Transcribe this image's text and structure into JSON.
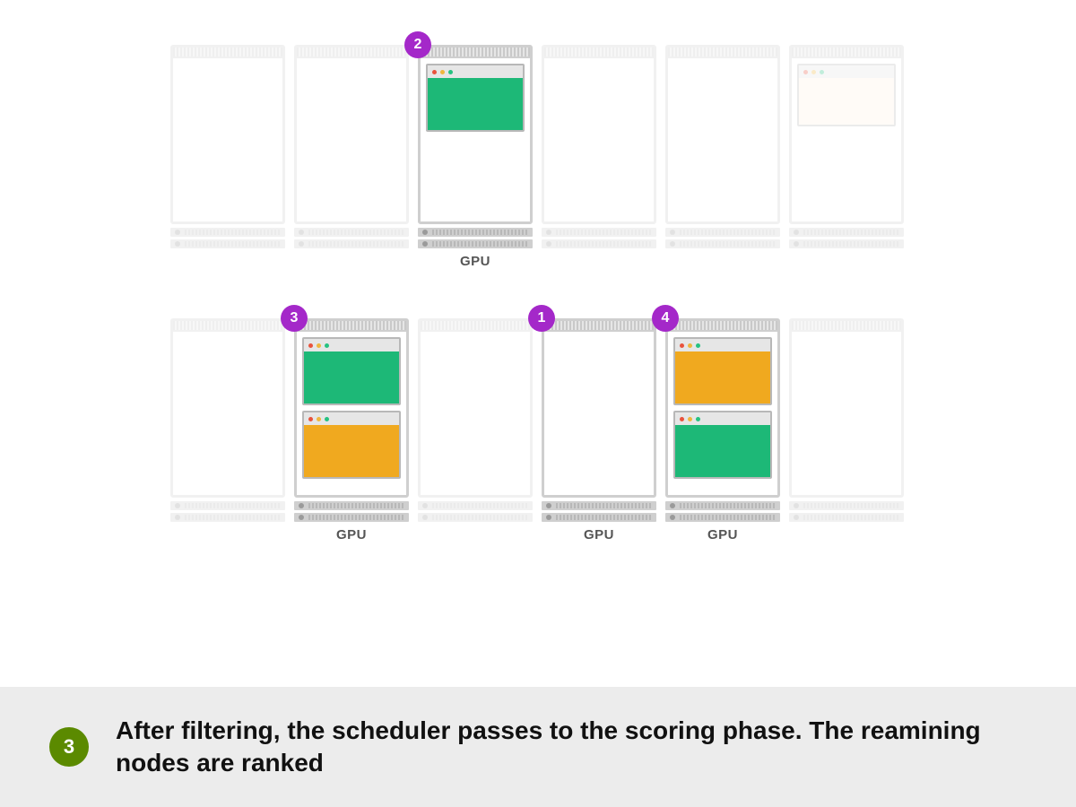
{
  "caption": {
    "step_number": "3",
    "text": "After filtering, the scheduler passes to the scoring phase. The reamining nodes are ranked"
  },
  "labels": {
    "gpu": "GPU"
  },
  "colors": {
    "rank_badge_bg": "#a428c9",
    "step_badge_bg": "#5b8a00",
    "pod_green": "#1db877",
    "pod_orange": "#f0a91f",
    "pod_cream": "#fff2e5"
  },
  "nodes": {
    "row1": [
      {
        "id": "r1n1",
        "faded": true,
        "rank": null,
        "gpu": false,
        "pods": []
      },
      {
        "id": "r1n2",
        "faded": true,
        "rank": null,
        "gpu": false,
        "pods": []
      },
      {
        "id": "r1n3",
        "faded": false,
        "rank": "2",
        "gpu": true,
        "pods": [
          {
            "color": "green"
          }
        ]
      },
      {
        "id": "r1n4",
        "faded": true,
        "rank": null,
        "gpu": false,
        "pods": []
      },
      {
        "id": "r1n5",
        "faded": true,
        "rank": null,
        "gpu": false,
        "pods": []
      },
      {
        "id": "r1n6",
        "faded": true,
        "rank": null,
        "gpu": false,
        "pods": [
          {
            "color": "cream"
          }
        ]
      }
    ],
    "row2": [
      {
        "id": "r2n1",
        "faded": true,
        "rank": null,
        "gpu": false,
        "pods": []
      },
      {
        "id": "r2n2",
        "faded": false,
        "rank": "3",
        "gpu": true,
        "pods": [
          {
            "color": "green"
          },
          {
            "color": "orange"
          }
        ]
      },
      {
        "id": "r2n3",
        "faded": true,
        "rank": null,
        "gpu": false,
        "pods": []
      },
      {
        "id": "r2n4",
        "faded": false,
        "rank": "1",
        "gpu": true,
        "pods": []
      },
      {
        "id": "r2n5",
        "faded": false,
        "rank": "4",
        "gpu": true,
        "pods": [
          {
            "color": "orange"
          },
          {
            "color": "green"
          }
        ]
      },
      {
        "id": "r2n6",
        "faded": true,
        "rank": null,
        "gpu": false,
        "pods": []
      }
    ]
  }
}
